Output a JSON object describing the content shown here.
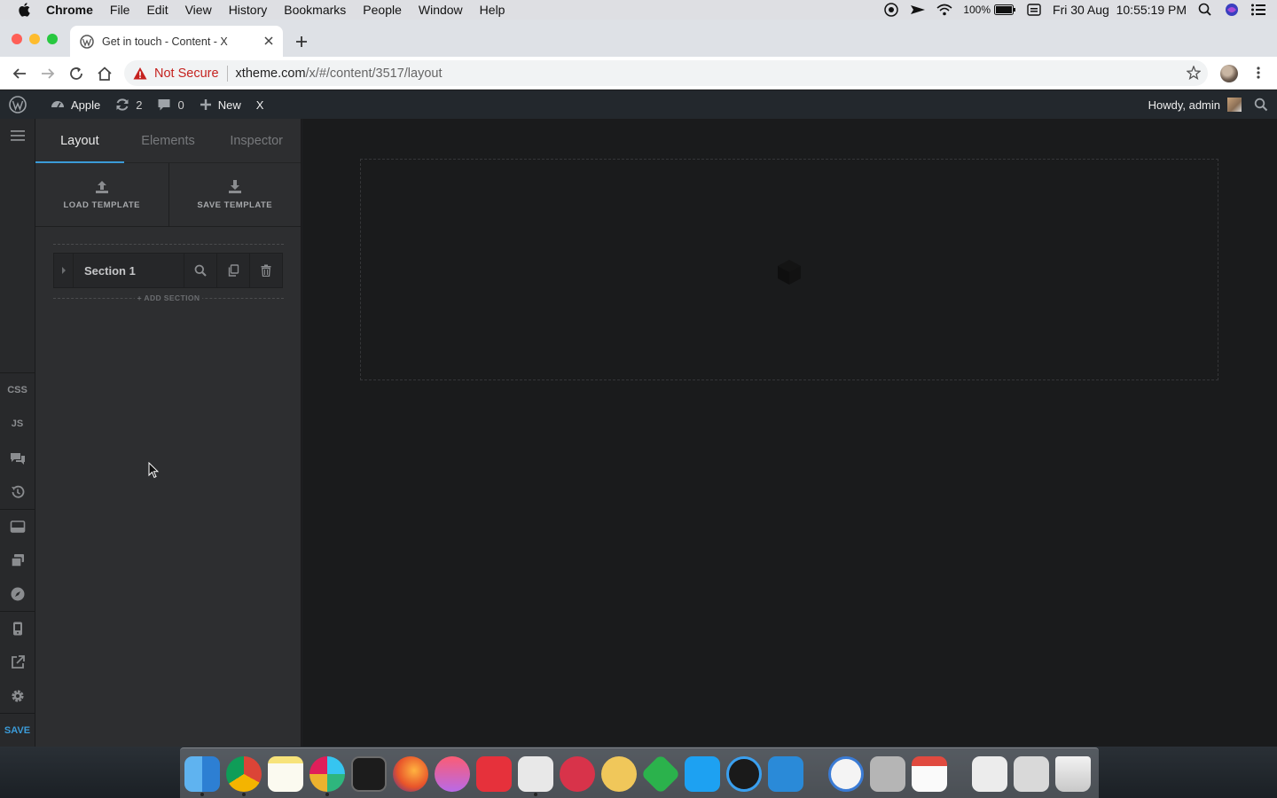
{
  "menubar": {
    "app": "Chrome",
    "items": [
      "File",
      "Edit",
      "View",
      "History",
      "Bookmarks",
      "People",
      "Window",
      "Help"
    ],
    "battery": "100%",
    "clock": "Fri 30 Aug  10:55:19 PM"
  },
  "browser": {
    "tab_title": "Get in touch - Content - X",
    "security_label": "Not Secure",
    "url_host": "xtheme.com",
    "url_path": "/x/#/content/3517/layout"
  },
  "wpbar": {
    "site": "Apple",
    "updates": "2",
    "comments": "0",
    "new_label": "New",
    "x_label": "X",
    "howdy": "Howdy, admin"
  },
  "iconbar": {
    "css": "CSS",
    "js": "JS",
    "save": "SAVE"
  },
  "panel": {
    "tabs": [
      "Layout",
      "Elements",
      "Inspector"
    ],
    "load_template": "LOAD TEMPLATE",
    "save_template": "SAVE TEMPLATE",
    "section_label": "Section 1",
    "add_section": "+ ADD SECTION"
  },
  "colors": {
    "accent": "#3b9bd8",
    "wp_bar": "#23282d",
    "panel": "#2d2e30",
    "canvas": "#1a1b1c"
  }
}
